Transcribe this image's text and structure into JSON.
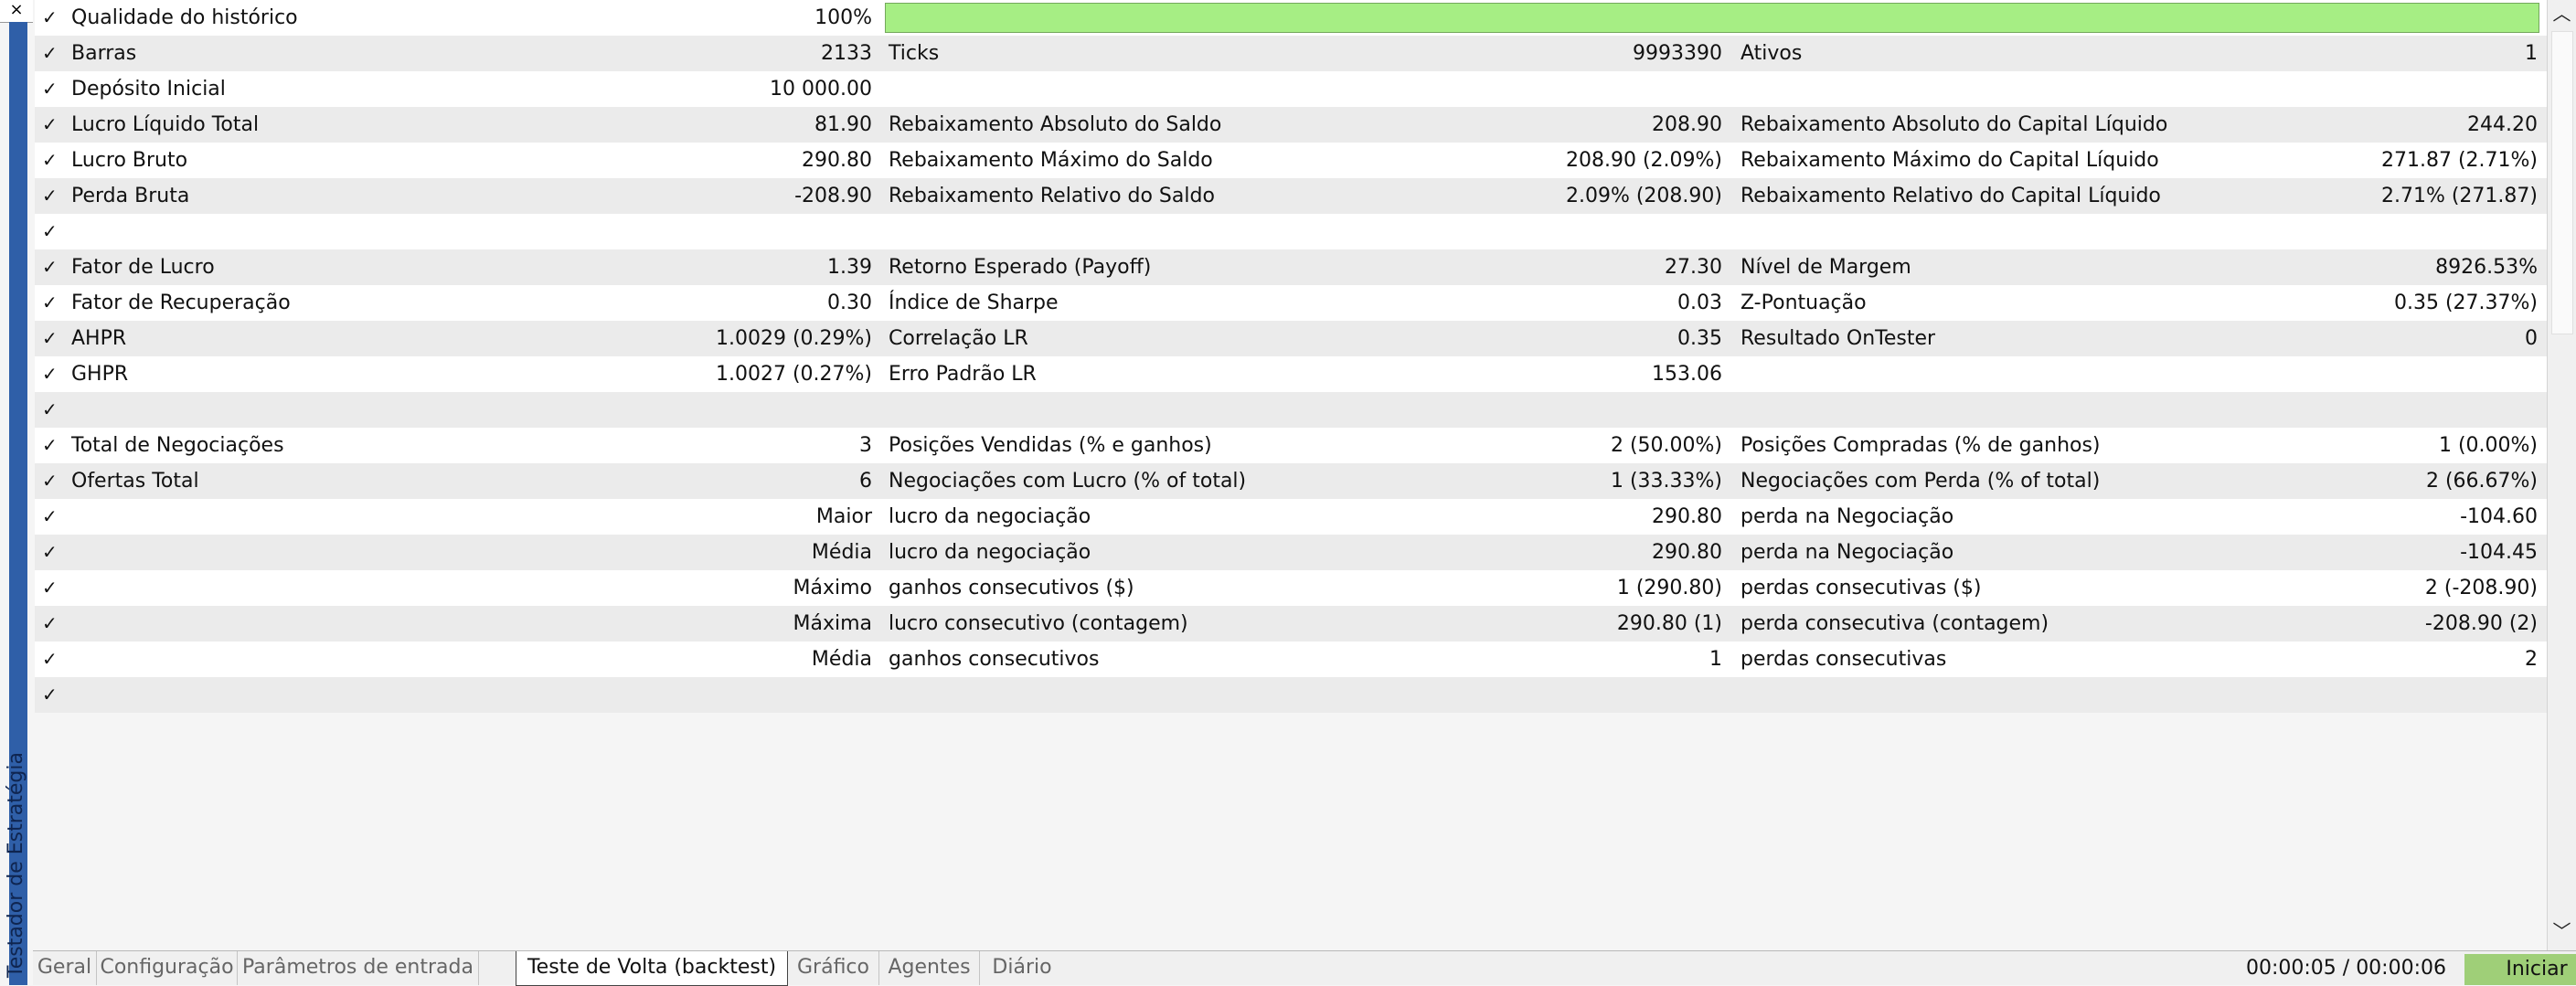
{
  "window": {
    "close_glyph": "×",
    "side_label": "Testador de Estratégia"
  },
  "report": {
    "rows": [
      {
        "c1": {
          "label": "Qualidade do histórico",
          "value": "100%"
        },
        "quality_bar": {
          "fill": 1.0,
          "color": "#a6ee84"
        }
      },
      {
        "c1": {
          "label": "Barras",
          "value": "2133"
        },
        "c2": {
          "label": "Ticks",
          "value": "9993390"
        },
        "c3": {
          "label": "Ativos",
          "value": "1"
        }
      },
      {
        "c1": {
          "label": "Depósito Inicial",
          "value": "10 000.00"
        }
      },
      {
        "c1": {
          "label": "Lucro Líquido Total",
          "value": "81.90"
        },
        "c2": {
          "label": "Rebaixamento Absoluto do Saldo",
          "value": "208.90"
        },
        "c3": {
          "label": "Rebaixamento Absoluto do Capital Líquido",
          "value": "244.20"
        }
      },
      {
        "c1": {
          "label": "Lucro Bruto",
          "value": "290.80"
        },
        "c2": {
          "label": "Rebaixamento Máximo do Saldo",
          "value": "208.90 (2.09%)"
        },
        "c3": {
          "label": "Rebaixamento Máximo do Capital Líquido",
          "value": "271.87 (2.71%)"
        }
      },
      {
        "c1": {
          "label": "Perda Bruta",
          "value": "-208.90"
        },
        "c2": {
          "label": "Rebaixamento Relativo do Saldo",
          "value": "2.09% (208.90)"
        },
        "c3": {
          "label": "Rebaixamento Relativo do Capital Líquido",
          "value": "2.71% (271.87)"
        }
      },
      {},
      {
        "c1": {
          "label": "Fator de Lucro",
          "value": "1.39"
        },
        "c2": {
          "label": "Retorno Esperado (Payoff)",
          "value": "27.30"
        },
        "c3": {
          "label": "Nível de Margem",
          "value": "8926.53%"
        }
      },
      {
        "c1": {
          "label": "Fator de Recuperação",
          "value": "0.30"
        },
        "c2": {
          "label": "Índice de Sharpe",
          "value": "0.03"
        },
        "c3": {
          "label": "Z-Pontuação",
          "value": "0.35 (27.37%)"
        }
      },
      {
        "c1": {
          "label": "AHPR",
          "value": "1.0029 (0.29%)"
        },
        "c2": {
          "label": "Correlação LR",
          "value": "0.35"
        },
        "c3": {
          "label": "Resultado OnTester",
          "value": "0"
        }
      },
      {
        "c1": {
          "label": "GHPR",
          "value": "1.0027 (0.27%)"
        },
        "c2": {
          "label": "Erro Padrão LR",
          "value": "153.06"
        }
      },
      {},
      {
        "c1": {
          "label": "Total de Negociações",
          "value": "3"
        },
        "c2": {
          "label": "Posições Vendidas (% e ganhos)",
          "value": "2 (50.00%)"
        },
        "c3": {
          "label": "Posições Compradas (% de ganhos)",
          "value": "1 (0.00%)"
        }
      },
      {
        "c1": {
          "label": "Ofertas Total",
          "value": "6"
        },
        "c2": {
          "label": "Negociações com Lucro (% of total)",
          "value": "1 (33.33%)"
        },
        "c3": {
          "label": "Negociações com Perda (% of total)",
          "value": "2 (66.67%)"
        }
      },
      {
        "c1": {
          "label": "",
          "value": "Maior"
        },
        "c2": {
          "label": "lucro da negociação",
          "value": "290.80"
        },
        "c3": {
          "label": "perda na Negociação",
          "value": "-104.60"
        }
      },
      {
        "c1": {
          "label": "",
          "value": "Média"
        },
        "c2": {
          "label": "lucro da negociação",
          "value": "290.80"
        },
        "c3": {
          "label": "perda na Negociação",
          "value": "-104.45"
        }
      },
      {
        "c1": {
          "label": "",
          "value": "Máximo"
        },
        "c2": {
          "label": "ganhos consecutivos ($)",
          "value": "1 (290.80)"
        },
        "c3": {
          "label": "perdas consecutivas ($)",
          "value": "2 (-208.90)"
        }
      },
      {
        "c1": {
          "label": "",
          "value": "Máxima"
        },
        "c2": {
          "label": "lucro consecutivo (contagem)",
          "value": "290.80 (1)"
        },
        "c3": {
          "label": "perda consecutiva (contagem)",
          "value": "-208.90 (2)"
        }
      },
      {
        "c1": {
          "label": "",
          "value": "Média"
        },
        "c2": {
          "label": "ganhos consecutivos",
          "value": "1"
        },
        "c3": {
          "label": "perdas consecutivas",
          "value": "2"
        }
      },
      {}
    ]
  },
  "scrollbar": {
    "up_glyph": "︿",
    "down_glyph": "﹀"
  },
  "tabs": [
    {
      "label": "Geral",
      "active": false
    },
    {
      "label": "Configuração",
      "active": false
    },
    {
      "label": "Parâmetros de entrada",
      "active": false
    },
    {
      "label": "Teste de Volta (backtest)",
      "active": true
    },
    {
      "label": "Gráfico",
      "active": false
    },
    {
      "label": "Agentes",
      "active": false
    },
    {
      "label": "Diário",
      "active": false
    }
  ],
  "status": {
    "timer": "00:00:05 / 00:00:06",
    "start_label": "Iniciar"
  }
}
